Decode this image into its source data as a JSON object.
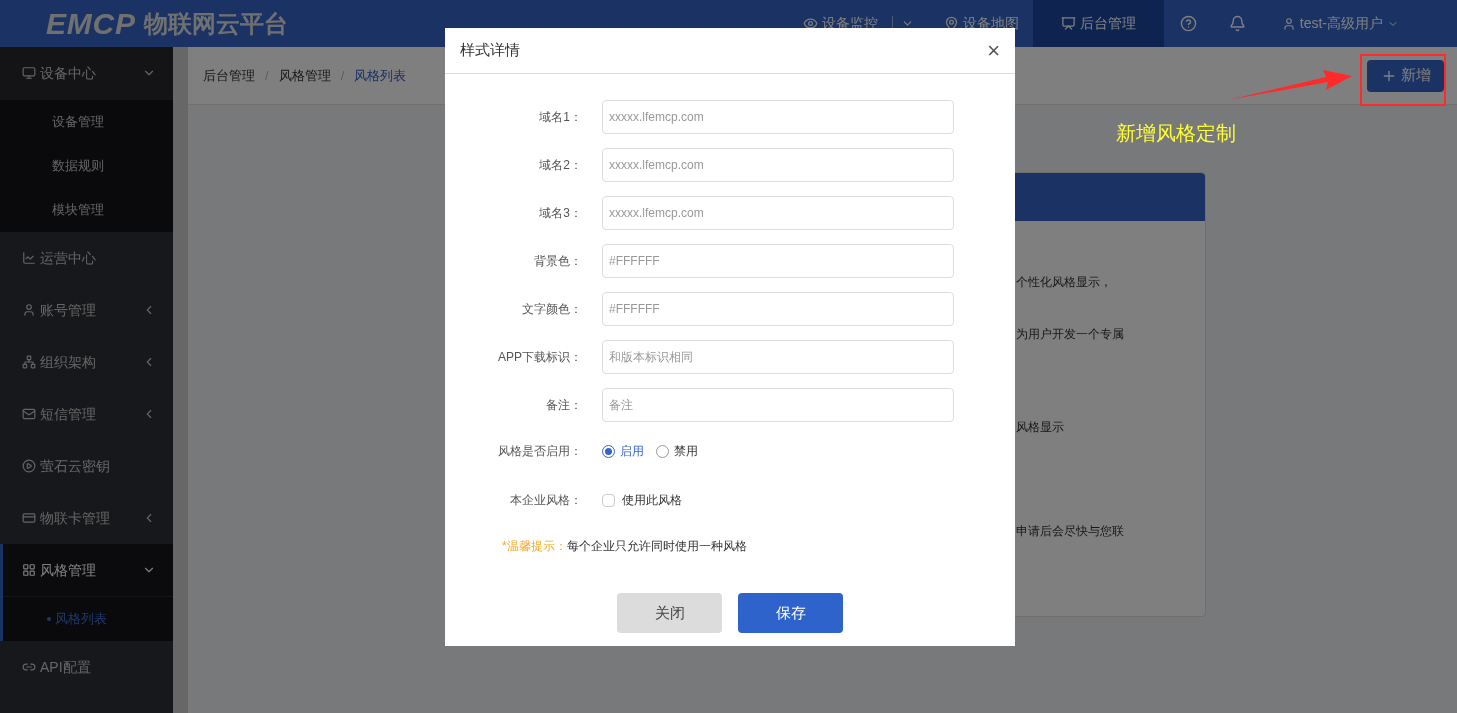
{
  "header": {
    "logo_mark": "EMCP",
    "logo_title": "物联网云平台",
    "nav": [
      {
        "label": "设备监控",
        "selected": false,
        "dropdown": true
      },
      {
        "label": "设备地图",
        "selected": false,
        "dropdown": false
      },
      {
        "label": "后台管理",
        "selected": true,
        "dropdown": false
      }
    ],
    "user": "test-高级用户"
  },
  "sidebar": {
    "items": [
      {
        "label": "设备中心",
        "expandable": true,
        "expanded": true,
        "selected": false,
        "children": [
          {
            "label": "设备管理",
            "selected": false
          },
          {
            "label": "数据规则",
            "selected": false
          },
          {
            "label": "模块管理",
            "selected": false
          }
        ]
      },
      {
        "label": "运营中心",
        "expandable": false,
        "selected": false
      },
      {
        "label": "账号管理",
        "expandable": true,
        "expanded": false,
        "selected": false
      },
      {
        "label": "组织架构",
        "expandable": true,
        "expanded": false,
        "selected": false
      },
      {
        "label": "短信管理",
        "expandable": true,
        "expanded": false,
        "selected": false
      },
      {
        "label": "萤石云密钥",
        "expandable": false,
        "selected": false
      },
      {
        "label": "物联卡管理",
        "expandable": true,
        "expanded": false,
        "selected": false
      },
      {
        "label": "风格管理",
        "expandable": true,
        "expanded": true,
        "selected": true,
        "children": [
          {
            "label": "风格列表",
            "selected": true
          }
        ]
      },
      {
        "label": "API配置",
        "expandable": false,
        "selected": false
      }
    ]
  },
  "breadcrumb_separator": "/",
  "breadcrumb": [
    {
      "label": "后台管理",
      "selected": false
    },
    {
      "label": "风格管理",
      "selected": false
    },
    {
      "label": "风格列表",
      "selected": true
    }
  ],
  "add_button": "新增",
  "annotation": "新增风格定制",
  "background_card": {
    "lines": [
      "个性化风格显示，",
      "为用户开发一个专属",
      "风格显示",
      "申请后会尽快与您联"
    ]
  },
  "dialog": {
    "title": "样式详情",
    "close": "×",
    "fields": [
      {
        "label": "域名1：",
        "placeholder": "xxxxx.lfemcp.com"
      },
      {
        "label": "域名2：",
        "placeholder": "xxxxx.lfemcp.com"
      },
      {
        "label": "域名3：",
        "placeholder": "xxxxx.lfemcp.com"
      },
      {
        "label": "背景色：",
        "placeholder": "#FFFFFF"
      },
      {
        "label": "文字颜色：",
        "placeholder": "#FFFFFF"
      },
      {
        "label": "APP下载标识：",
        "placeholder": "和版本标识相同"
      },
      {
        "label": "备注：",
        "placeholder": "备注"
      }
    ],
    "radio": {
      "label": "风格是否启用：",
      "options": [
        {
          "label": "启用",
          "selected": true
        },
        {
          "label": "禁用",
          "selected": false
        }
      ]
    },
    "checkbox": {
      "label": "本企业风格：",
      "option": "使用此风格",
      "checked": false
    },
    "tip": {
      "prefix": "*温馨提示：",
      "text": "每个企业只允许同时使用一种风格"
    },
    "buttons": [
      {
        "label": "关闭",
        "kind": "secondary"
      },
      {
        "label": "保存",
        "kind": "primary"
      }
    ]
  }
}
